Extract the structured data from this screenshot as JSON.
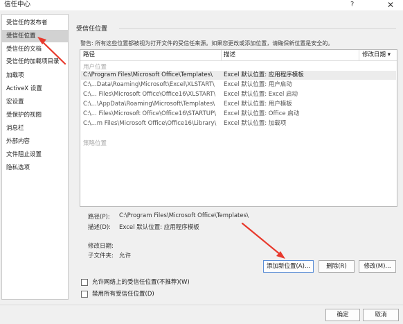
{
  "window": {
    "title": "信任中心",
    "help": "?",
    "close": "✕"
  },
  "sidebar": {
    "items": [
      {
        "label": "受信任的发布者"
      },
      {
        "label": "受信任位置"
      },
      {
        "label": "受信任的文档"
      },
      {
        "label": "受信任的加载项目录"
      },
      {
        "label": "加载项"
      },
      {
        "label": "ActiveX 设置"
      },
      {
        "label": "宏设置"
      },
      {
        "label": "受保护的视图"
      },
      {
        "label": "消息栏"
      },
      {
        "label": "外部内容"
      },
      {
        "label": "文件阻止设置"
      },
      {
        "label": "隐私选项"
      }
    ],
    "selected_index": 1
  },
  "main": {
    "section_title": "受信任位置",
    "warning": "警告: 所有这些位置都被视为打开文件的受信任来源。如果您更改或添加位置，请确保新位置是安全的。",
    "table": {
      "columns": [
        "路径",
        "描述",
        "修改日期 ▾"
      ],
      "group_user": "用户位置",
      "rows": [
        {
          "path": "C:\\Program Files\\Microsoft Office\\Templates\\",
          "desc": "Excel 默认位置: 应用程序模板"
        },
        {
          "path": "C:\\...Data\\Roaming\\Microsoft\\Excel\\XLSTART\\",
          "desc": "Excel 默认位置: 用户启动"
        },
        {
          "path": "C:\\... Files\\Microsoft Office\\Office16\\XLSTART\\",
          "desc": "Excel 默认位置: Excel 启动"
        },
        {
          "path": "C:\\...\\AppData\\Roaming\\Microsoft\\Templates\\",
          "desc": "Excel 默认位置: 用户模板"
        },
        {
          "path": "C:\\... Files\\Microsoft Office\\Office16\\STARTUP\\",
          "desc": "Excel 默认位置: Office 启动"
        },
        {
          "path": "C:\\...m Files\\Microsoft Office\\Office16\\Library\\",
          "desc": "Excel 默认位置: 加载项"
        }
      ],
      "selected_row": 0,
      "group_policy": "策略位置"
    },
    "details": {
      "path_label": "路径(P):",
      "path_value": "C:\\Program Files\\Microsoft Office\\Templates\\",
      "desc_label": "描述(D):",
      "desc_value": "Excel 默认位置: 应用程序模板",
      "date_label": "修改日期:",
      "subfolder_label": "子文件夹:",
      "subfolder_value": "允许"
    },
    "buttons": {
      "add": "添加新位置(A)...",
      "remove": "删除(R)",
      "modify": "修改(M)..."
    },
    "checkboxes": {
      "allow_network": "允许网络上的受信任位置(不推荐)(W)",
      "disable_all": "禁用所有受信任位置(D)"
    }
  },
  "footer": {
    "ok": "确定",
    "cancel": "取消"
  },
  "colors": {
    "annotation_arrow": "#e8392c",
    "selected_bg": "#d2d2d2"
  }
}
